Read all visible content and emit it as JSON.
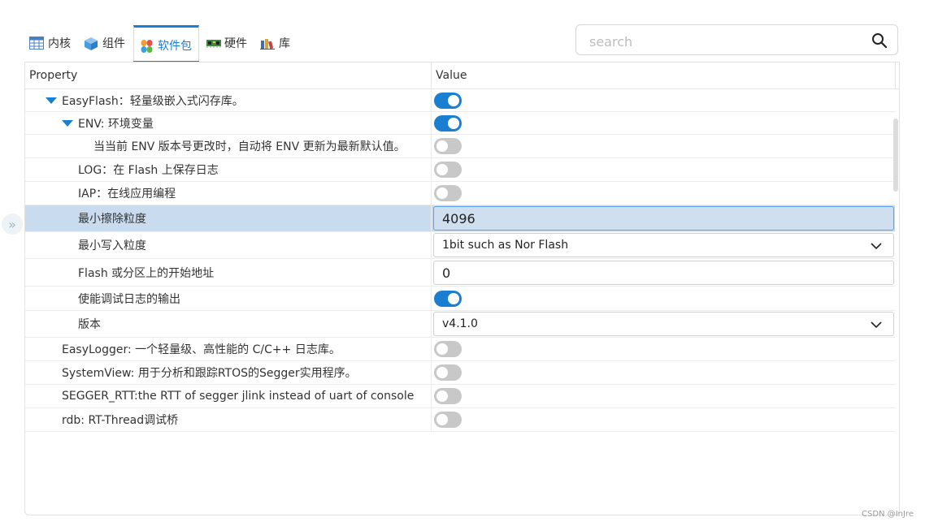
{
  "tabs": [
    {
      "label": "内核",
      "icon": "table-icon"
    },
    {
      "label": "组件",
      "icon": "cube-icon"
    },
    {
      "label": "软件包",
      "icon": "packages-icon",
      "active": true
    },
    {
      "label": "硬件",
      "icon": "board-icon"
    },
    {
      "label": "库",
      "icon": "library-icon"
    }
  ],
  "search": {
    "placeholder": "search",
    "value": ""
  },
  "table": {
    "headers": {
      "property": "Property",
      "value": "Value"
    },
    "rows": [
      {
        "label": "EasyFlash：轻量级嵌入式闪存库。",
        "expander": "expanded",
        "control": "toggle",
        "on": true
      },
      {
        "label": "ENV: 环境变量",
        "expander": "expanded",
        "control": "toggle",
        "on": true
      },
      {
        "label": "当当前 ENV 版本号更改时，自动将 ENV 更新为最新默认值。",
        "control": "toggle",
        "on": false
      },
      {
        "label": "LOG：在 Flash 上保存日志",
        "control": "toggle",
        "on": false
      },
      {
        "label": "IAP：在线应用编程",
        "control": "toggle",
        "on": false
      },
      {
        "label": "最小擦除粒度",
        "control": "input",
        "value": "4096",
        "selected": true
      },
      {
        "label": "最小写入粒度",
        "control": "select",
        "value": "1bit such as Nor Flash"
      },
      {
        "label": "Flash 或分区上的开始地址",
        "control": "input",
        "value": "0"
      },
      {
        "label": "使能调试日志的输出",
        "control": "toggle",
        "on": true
      },
      {
        "label": "版本",
        "control": "select",
        "value": "v4.1.0"
      },
      {
        "label": "EasyLogger: 一个轻量级、高性能的 C/C++ 日志库。",
        "control": "toggle",
        "on": false
      },
      {
        "label": "SystemView: 用于分析和跟踪RTOS的Segger实用程序。",
        "control": "toggle",
        "on": false
      },
      {
        "label": "SEGGER_RTT:the RTT of segger jlink instead of uart of console",
        "control": "toggle",
        "on": false
      },
      {
        "label": "rdb: RT-Thread调试桥",
        "control": "toggle",
        "on": false
      }
    ]
  },
  "watermark": "CSDN @InJre",
  "colors": {
    "accent": "#1a7fd1",
    "selected_row": "#c9dcef",
    "toggle_off": "#c8c8c8"
  }
}
